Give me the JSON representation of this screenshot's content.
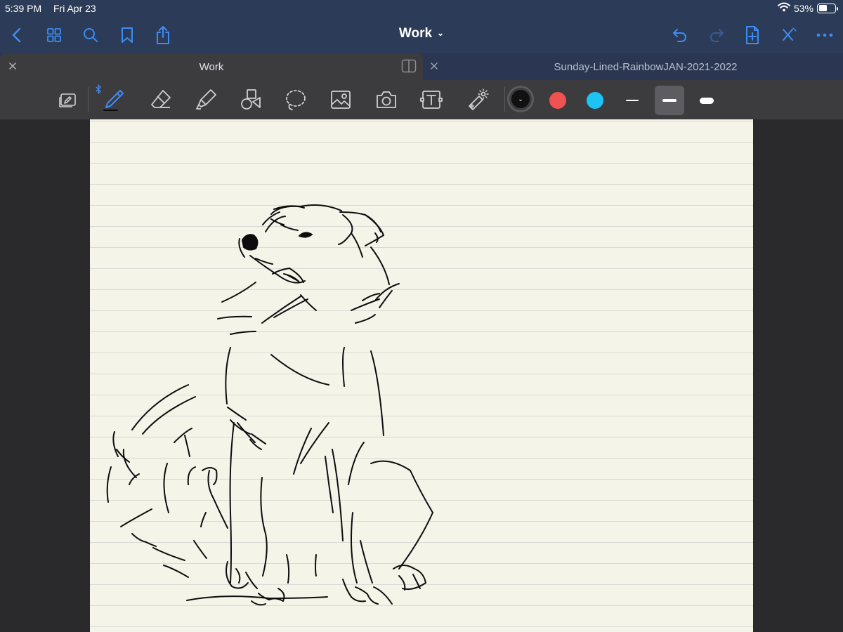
{
  "status_bar": {
    "time": "5:39 PM",
    "date": "Fri Apr 23",
    "battery_percent": "53%",
    "battery_level": 0.53,
    "wifi_icon": "wifi-icon"
  },
  "nav_bar": {
    "title": "Work",
    "left_icons": [
      "back-chevron-icon",
      "grid-icon",
      "search-icon",
      "bookmark-icon",
      "share-icon"
    ],
    "right_icons": [
      "undo-icon",
      "redo-icon",
      "add-page-icon",
      "close-pen-icon",
      "more-icon"
    ],
    "accent_color": "#3d8df5"
  },
  "tabs": [
    {
      "label": "Work",
      "active": true
    },
    {
      "label": "Sunday-Lined-RainbowJAN-2021-2022",
      "active": false
    }
  ],
  "toolbar": {
    "tools": [
      "read-mode-icon",
      "pen-icon",
      "eraser-icon",
      "highlighter-icon",
      "shapes-icon",
      "lasso-icon",
      "image-icon",
      "camera-icon",
      "text-icon",
      "laser-pointer-icon"
    ],
    "selected_tool": "pen-icon",
    "bluetooth_icon": "bluetooth-icon",
    "colors": [
      "#111111",
      "#f05151",
      "#1ec3f5"
    ],
    "selected_color": "#111111",
    "stroke_widths": [
      "thin",
      "medium",
      "thick"
    ],
    "selected_width": "medium"
  },
  "canvas": {
    "paper_color": "#f5f4e9",
    "line_color": "#d9dad6",
    "content": "sketch of a sitting dog"
  }
}
